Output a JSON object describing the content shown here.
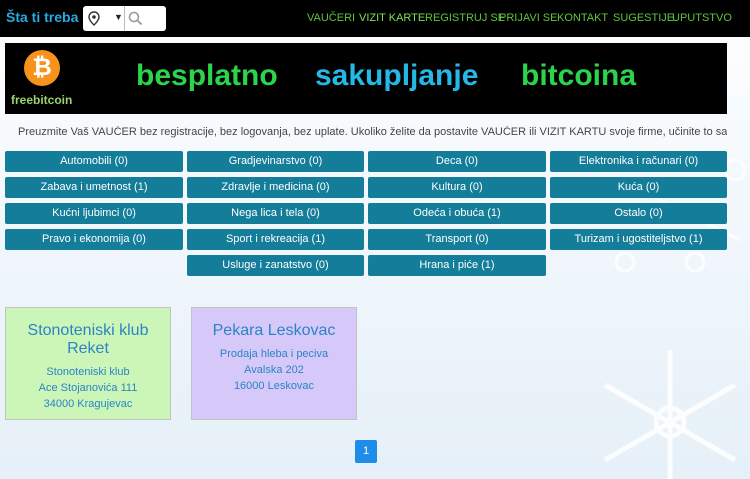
{
  "header": {
    "brand": "Šta ti treba",
    "nav": [
      "VAUČERI",
      "VIZIT KARTE",
      "REGISTRUJ SE",
      "PRIJAVI SE",
      "KONTAKT",
      "SUGESTIJE",
      "UPUTSTVO"
    ]
  },
  "banner": {
    "coin_symbol": "₿",
    "logo_text": "freebitcoin",
    "words": [
      "besplatno",
      "sakupljanje",
      "bitcoina"
    ]
  },
  "intro": "Preuzmite Vaš VAUČER bez registracije, bez logovanja, bez uplate. Ukoliko želite da postavite VAUČER ili VIZIT KARTU svoje firme, učinite to sami t",
  "categories": [
    "Automobili (0)",
    "Gradjevinarstvo (0)",
    "Deca (0)",
    "Elektronika i računari (0)",
    "Zabava i umetnost (1)",
    "Zdravlje i medicina (0)",
    "Kultura (0)",
    "Kuća (0)",
    "Kućni ljubimci (0)",
    "Nega lica i tela (0)",
    "Odeća i obuća (1)",
    "Ostalo (0)",
    "Pravo i ekonomija (0)",
    "Sport i rekreacija (1)",
    "Transport (0)",
    "Turizam i ugostiteljstvo (1)",
    "Usluge i zanatstvo (0)",
    "Hrana i piće (1)"
  ],
  "cards": [
    {
      "name": "Stonoteniski klub Reket",
      "lines": [
        "Stonoteniski klub",
        "Ace Stojanovića 111",
        "34000 Kragujevac"
      ]
    },
    {
      "name": "Pekara Leskovac",
      "lines": [
        "Prodaja hleba i peciva",
        "Avalska 202",
        "16000 Leskovac"
      ]
    }
  ],
  "pagination": {
    "current": "1"
  },
  "colors": {
    "nav": "#5ec53b",
    "category_bg": "#147d99",
    "card1_bg": "#ccf5b8",
    "card2_bg": "#d6c9f9",
    "brand": "#27a9e1"
  }
}
